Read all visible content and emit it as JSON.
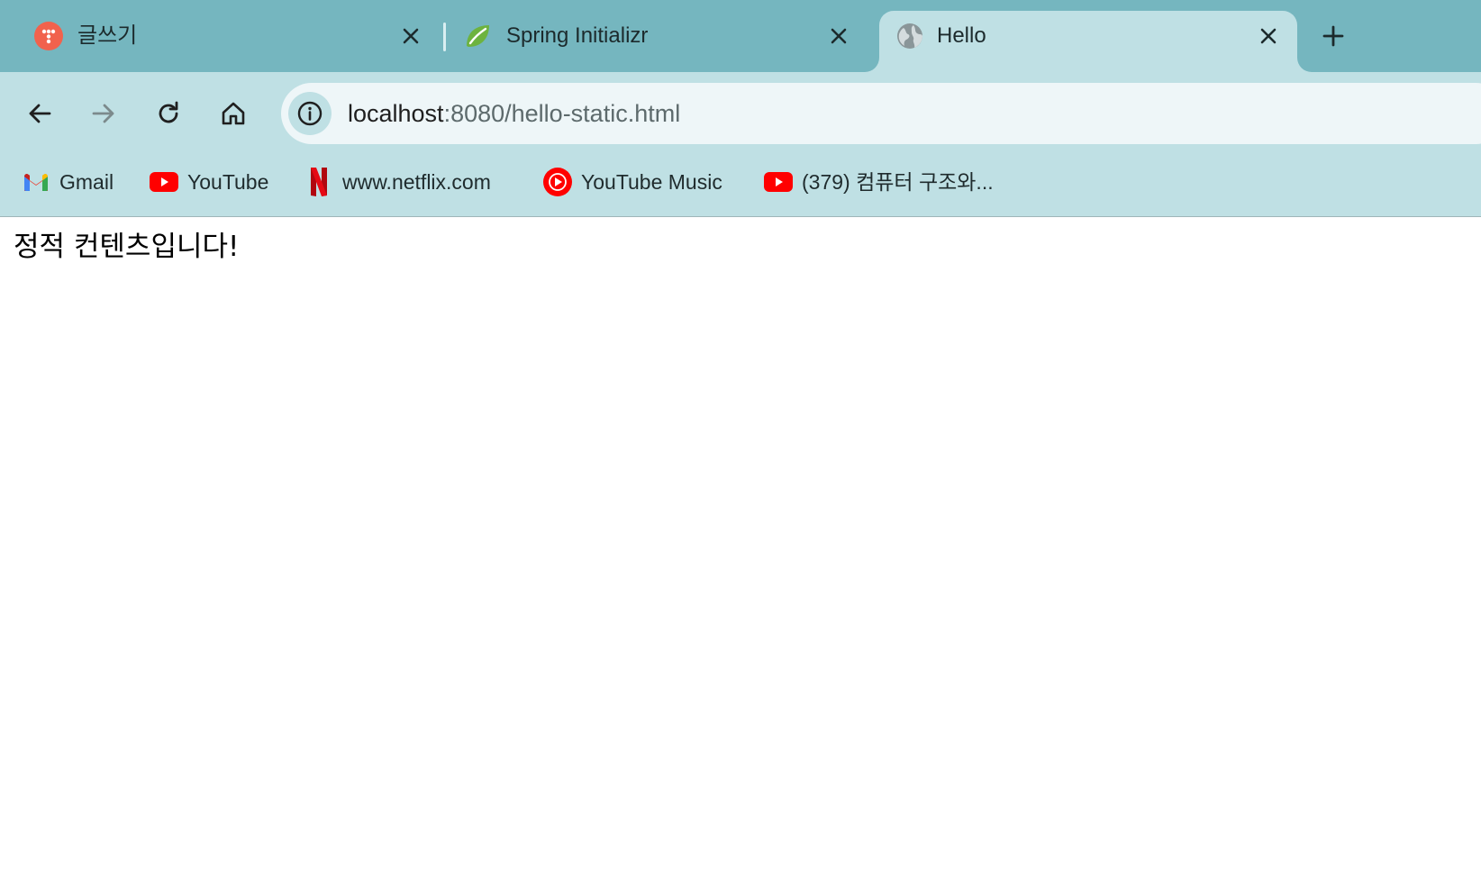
{
  "tabs": [
    {
      "title": "글쓰기",
      "icon": "tistory-icon",
      "active": false
    },
    {
      "title": "Spring Initializr",
      "icon": "spring-leaf-icon",
      "active": false
    },
    {
      "title": "Hello",
      "icon": "globe-icon",
      "active": true
    }
  ],
  "toolbar": {
    "url_host": "localhost",
    "url_path": ":8080/hello-static.html"
  },
  "bookmarks": [
    {
      "label": "Gmail",
      "icon": "gmail-icon"
    },
    {
      "label": "YouTube",
      "icon": "youtube-icon"
    },
    {
      "label": "www.netflix.com",
      "icon": "netflix-icon"
    },
    {
      "label": "YouTube Music",
      "icon": "youtube-music-icon"
    },
    {
      "label": "(379) 컴퓨터 구조와...",
      "icon": "youtube-icon"
    }
  ],
  "page": {
    "text": "정적 컨텐츠입니다!"
  },
  "colors": {
    "tabstrip": "#75b6bf",
    "toolbar": "#bfe0e4",
    "omnibox": "#eef6f8",
    "youtube_red": "#ff0000",
    "netflix_red": "#b1060f",
    "tistory_orange": "#f1624d",
    "spring_green": "#6db33f"
  }
}
